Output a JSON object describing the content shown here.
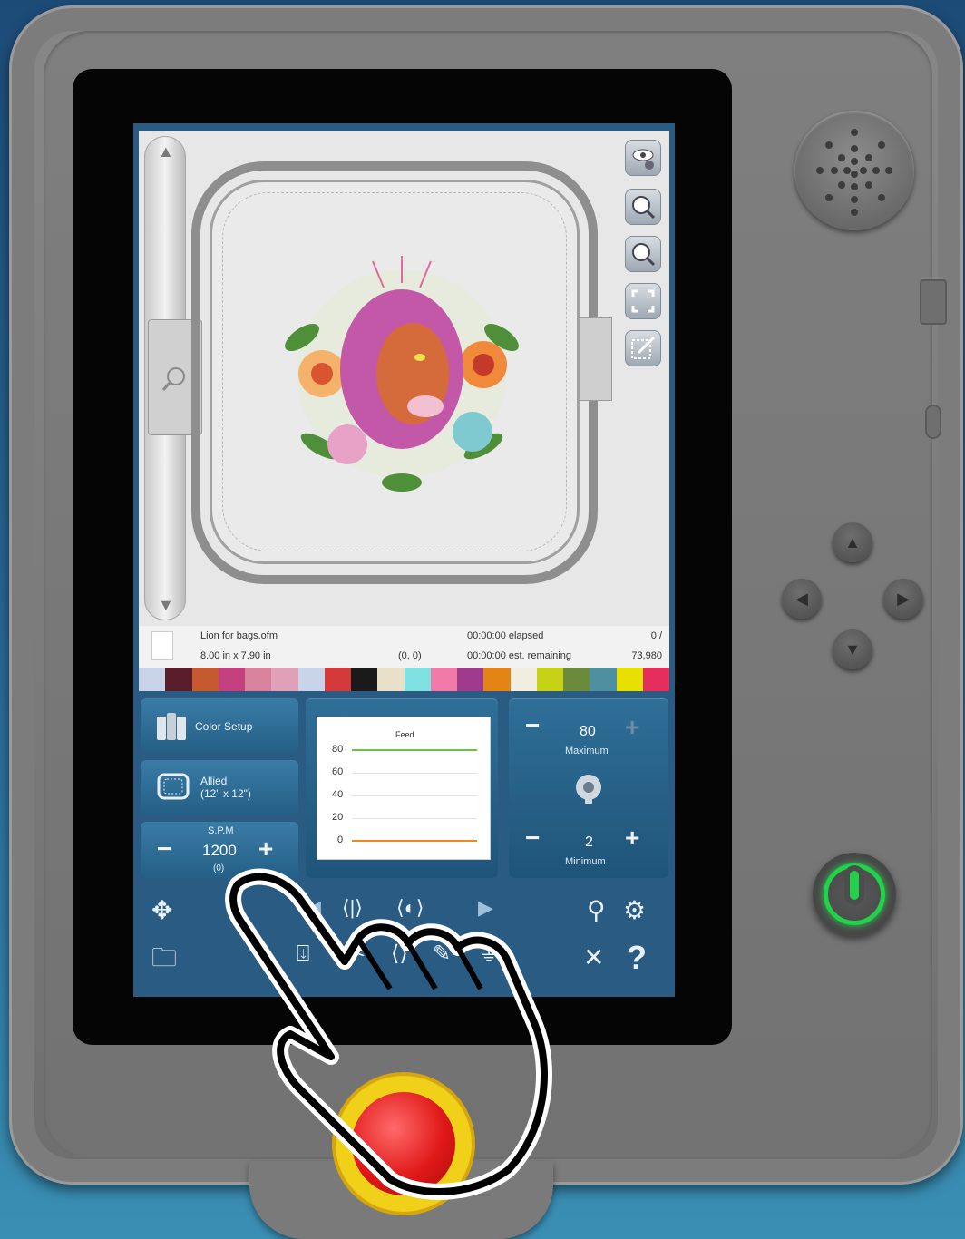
{
  "design": {
    "file_name": "Lion for bags.ofm",
    "dimensions": "8.00 in x 7.90 in",
    "coords": "(0, 0)",
    "elapsed": "00:00:00 elapsed",
    "remaining": "00:00:00 est. remaining",
    "stitch_progress": "0 /",
    "stitch_total": "73,980"
  },
  "color_sequence": [
    "#c9d4ea",
    "#5a1e2a",
    "#c45a2e",
    "#c4407e",
    "#d9829e",
    "#e0a0b8",
    "#c9d4ea",
    "#d43a3a",
    "#1a1a1a",
    "#e8e0c8",
    "#7ee0e0",
    "#f27aa8",
    "#9e3b8c",
    "#e38414",
    "#f1eee1",
    "#c7d216",
    "#6b8a3c",
    "#4e8fa0",
    "#e8e000",
    "#e62e5e"
  ],
  "panel": {
    "color_setup_label": "Color Setup",
    "hoop_name": "Allied",
    "hoop_size": "(12\" x 12\")",
    "spm_label": "S.P.M",
    "spm_value": "1200",
    "spm_sub": "(0)",
    "max_value": "80",
    "max_label": "Maximum",
    "min_value": "2",
    "min_label": "Minimum"
  },
  "chart_data": {
    "type": "line",
    "title": "Feed",
    "yticks": [
      "80",
      "60",
      "40",
      "20",
      "0"
    ],
    "ylim": [
      0,
      80
    ],
    "series": [
      {
        "color": "#6cc04a",
        "values": [
          80,
          80
        ]
      },
      {
        "color": "#f08a20",
        "values": [
          0,
          0
        ]
      }
    ]
  },
  "colors": {
    "screen_bg": "#2a5b82",
    "power_green": "#22d24a",
    "estop_red": "#e01818",
    "estop_yellow": "#f0d019"
  }
}
